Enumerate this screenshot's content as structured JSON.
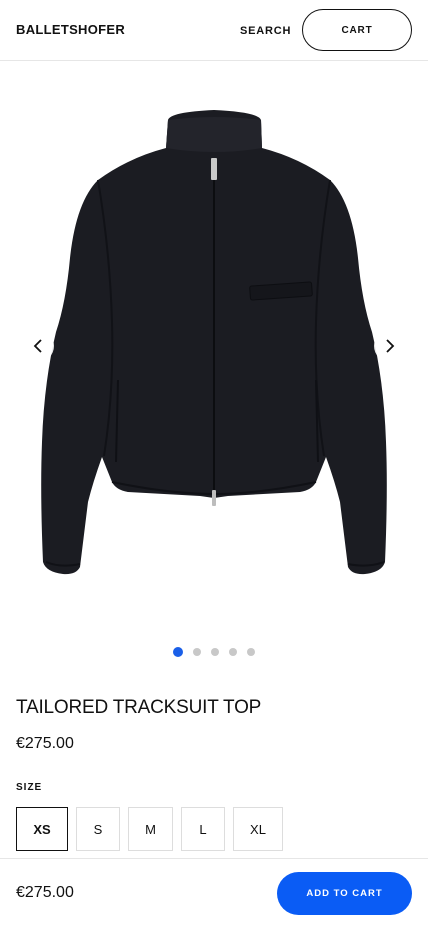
{
  "header": {
    "brand": "BALLETSHOFER",
    "search_label": "SEARCH",
    "cart_label": "CART"
  },
  "gallery": {
    "image_count": 5,
    "active_index": 0,
    "prev_icon": "chevron-left-icon",
    "next_icon": "chevron-right-icon"
  },
  "product": {
    "title": "TAILORED TRACKSUIT TOP",
    "price": "€275.00",
    "size_label": "SIZE",
    "sizes": [
      "XS",
      "S",
      "M",
      "L",
      "XL"
    ],
    "selected_size": "XS"
  },
  "bottom_bar": {
    "price": "€275.00",
    "add_to_cart_label": "ADD TO CART"
  },
  "colors": {
    "accent": "#0a5cf5",
    "dot_active": "#1a5fe8",
    "dot_inactive": "#c8c8c8"
  }
}
